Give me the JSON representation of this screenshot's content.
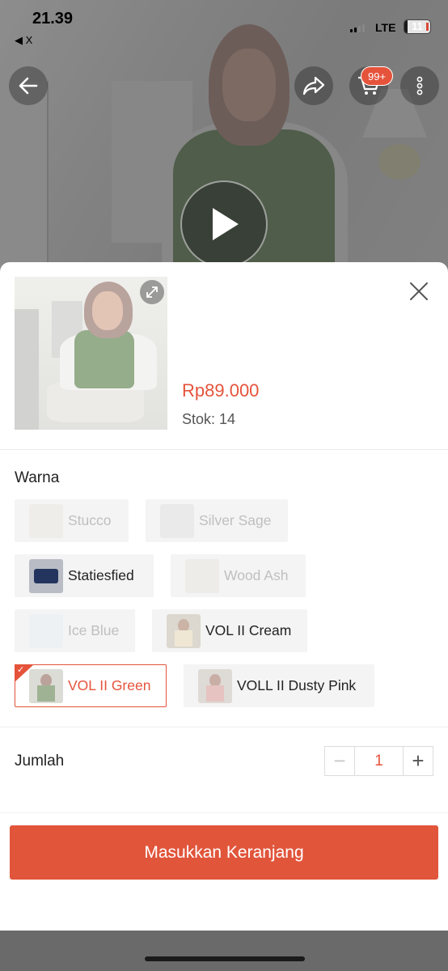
{
  "status_bar": {
    "time": "21.39",
    "back_app": "◀ X",
    "network": "LTE",
    "battery": "11",
    "battery_level": 0.11
  },
  "header": {
    "cart_badge": "99+"
  },
  "product": {
    "price": "Rp89.000",
    "stock": "Stok: 14"
  },
  "variant_section": {
    "title": "Warna",
    "options": [
      {
        "label": "Stucco",
        "state": "disabled"
      },
      {
        "label": "Silver Sage",
        "state": "disabled"
      },
      {
        "label": "Statiesfied",
        "state": "available"
      },
      {
        "label": "Wood Ash",
        "state": "disabled"
      },
      {
        "label": "Ice Blue",
        "state": "disabled"
      },
      {
        "label": "VOL II Cream",
        "state": "available"
      },
      {
        "label": "VOL II Green",
        "state": "selected"
      },
      {
        "label": "VOLL II Dusty Pink",
        "state": "available"
      }
    ]
  },
  "quantity": {
    "label": "Jumlah",
    "value": "1",
    "minus": "−",
    "plus": "+"
  },
  "actions": {
    "add_to_cart": "Masukkan Keranjang"
  },
  "colors": {
    "accent": "#e5533b",
    "disabled_text": "#bfbfbf"
  }
}
